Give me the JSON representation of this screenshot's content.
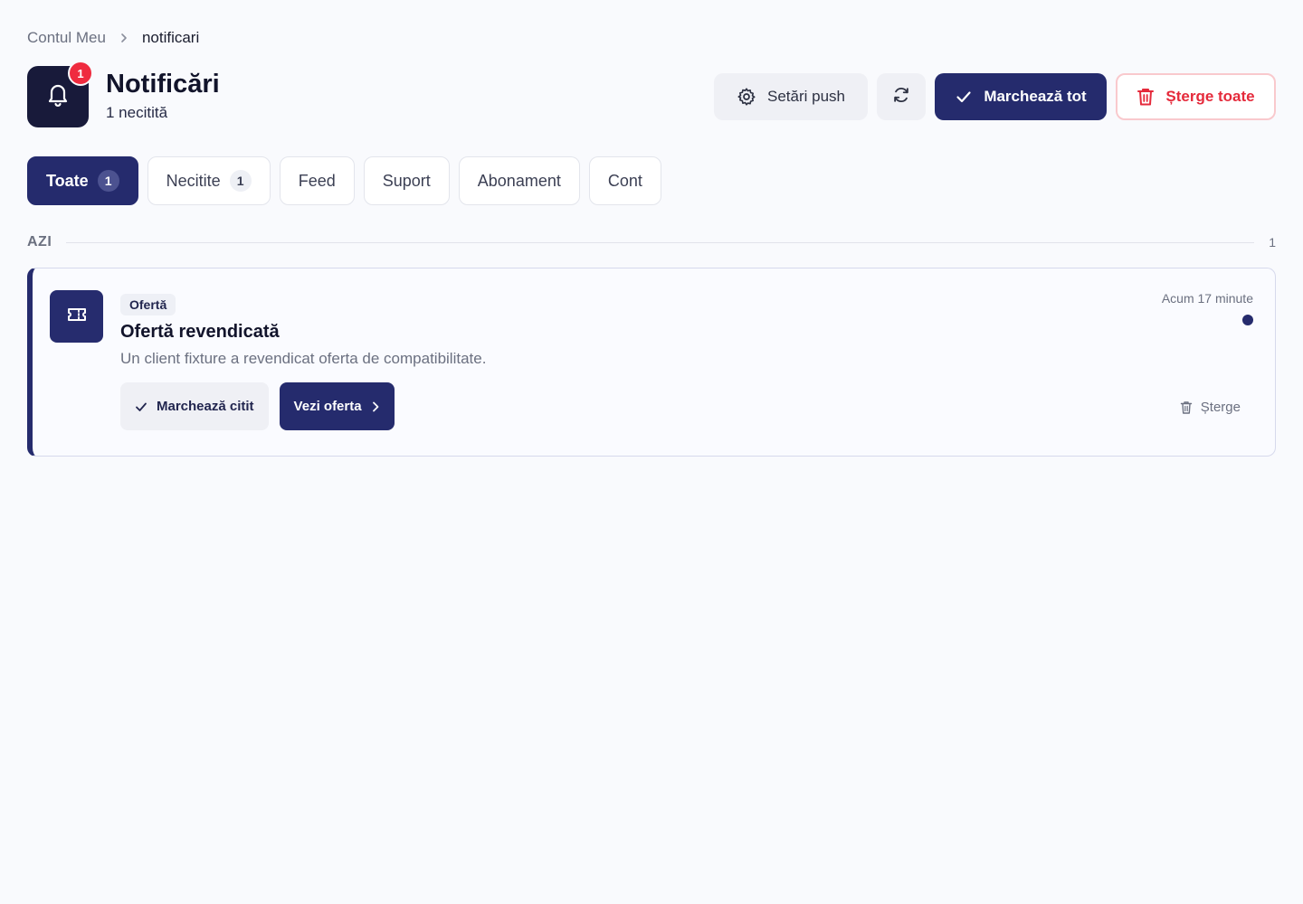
{
  "breadcrumb": {
    "parent": "Contul Meu",
    "current": "notificari"
  },
  "header": {
    "title": "Notificări",
    "subtitle": "1 necitită",
    "badge_count": "1",
    "actions": {
      "push_settings": "Setări push",
      "mark_all": "Marchează tot",
      "delete_all": "Șterge toate"
    }
  },
  "tabs": [
    {
      "label": "Toate",
      "count": "1",
      "active": true
    },
    {
      "label": "Necitite",
      "count": "1",
      "active": false
    },
    {
      "label": "Feed",
      "active": false
    },
    {
      "label": "Suport",
      "active": false
    },
    {
      "label": "Abonament",
      "active": false
    },
    {
      "label": "Cont",
      "active": false
    }
  ],
  "section": {
    "label": "AZI",
    "count": "1"
  },
  "notification": {
    "category": "Ofertă",
    "title": "Ofertă revendicată",
    "description": "Un client fixture a revendicat oferta de compatibilitate.",
    "time": "Acum 17 minute",
    "unread": true,
    "mark_read_label": "Marchează citit",
    "view_label": "Vezi oferta",
    "delete_label": "Șterge"
  },
  "colors": {
    "primary": "#252b6d",
    "danger": "#e52a3b",
    "badge": "#ef2b3f",
    "background": "#f9fafd"
  },
  "icons": {
    "header": "bell-icon",
    "push_settings": "gear-icon",
    "refresh": "refresh-icon",
    "mark_all": "check-icon",
    "delete_all": "trash-icon",
    "notification": "ticket-icon",
    "view": "chevron-right-icon"
  }
}
